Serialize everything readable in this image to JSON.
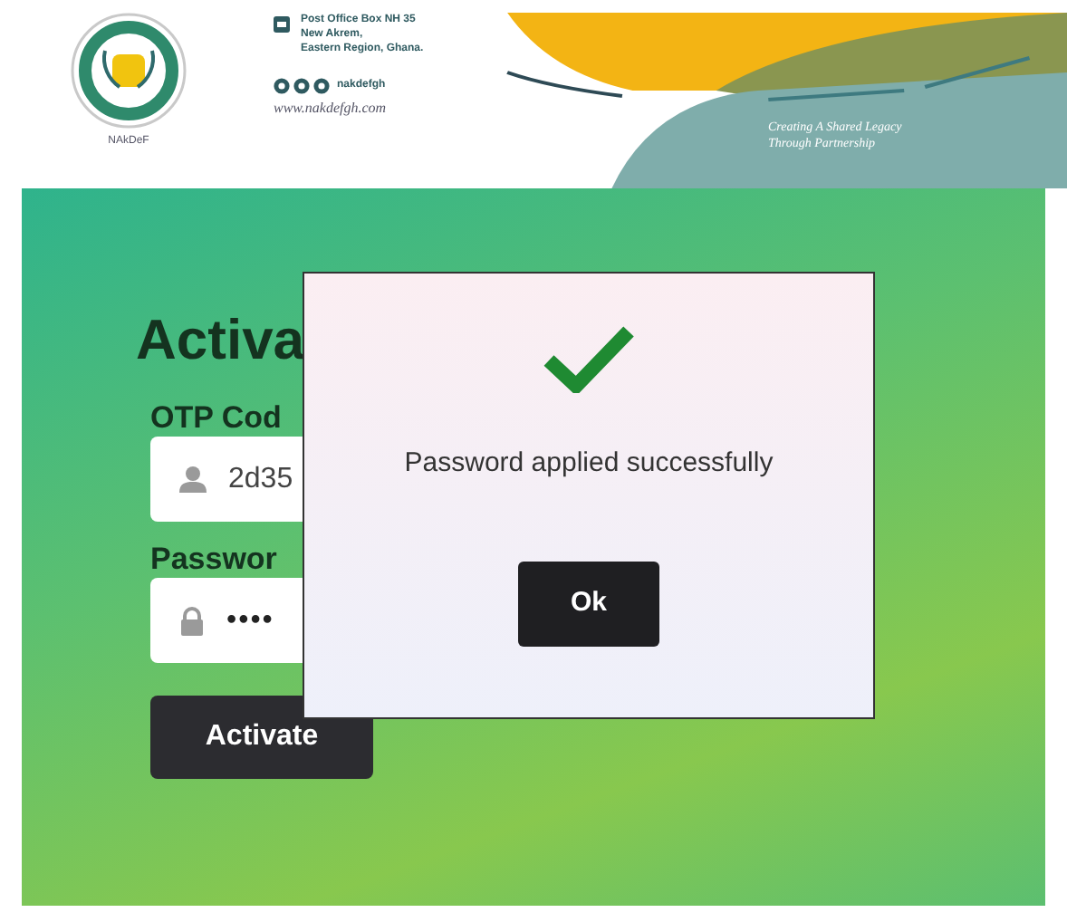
{
  "header": {
    "logo_caption": "NAkDeF",
    "address_lines": [
      "Post Office Box NH 35",
      "New Akrem,",
      "Eastern Region, Ghana."
    ],
    "social_handle": "nakdefgh",
    "website": "www.nakdefgh.com",
    "tagline_lines": [
      "Creating A Shared Legacy",
      "Through Partnership"
    ]
  },
  "form": {
    "title": "Activa",
    "fields": [
      {
        "label": "OTP Cod",
        "kind": "text",
        "value": "2d35"
      },
      {
        "label": "Passwor",
        "kind": "password",
        "value": "••••"
      }
    ],
    "submit": "Activate"
  },
  "dialog": {
    "message": "Password applied successfully",
    "button": "Ok"
  }
}
